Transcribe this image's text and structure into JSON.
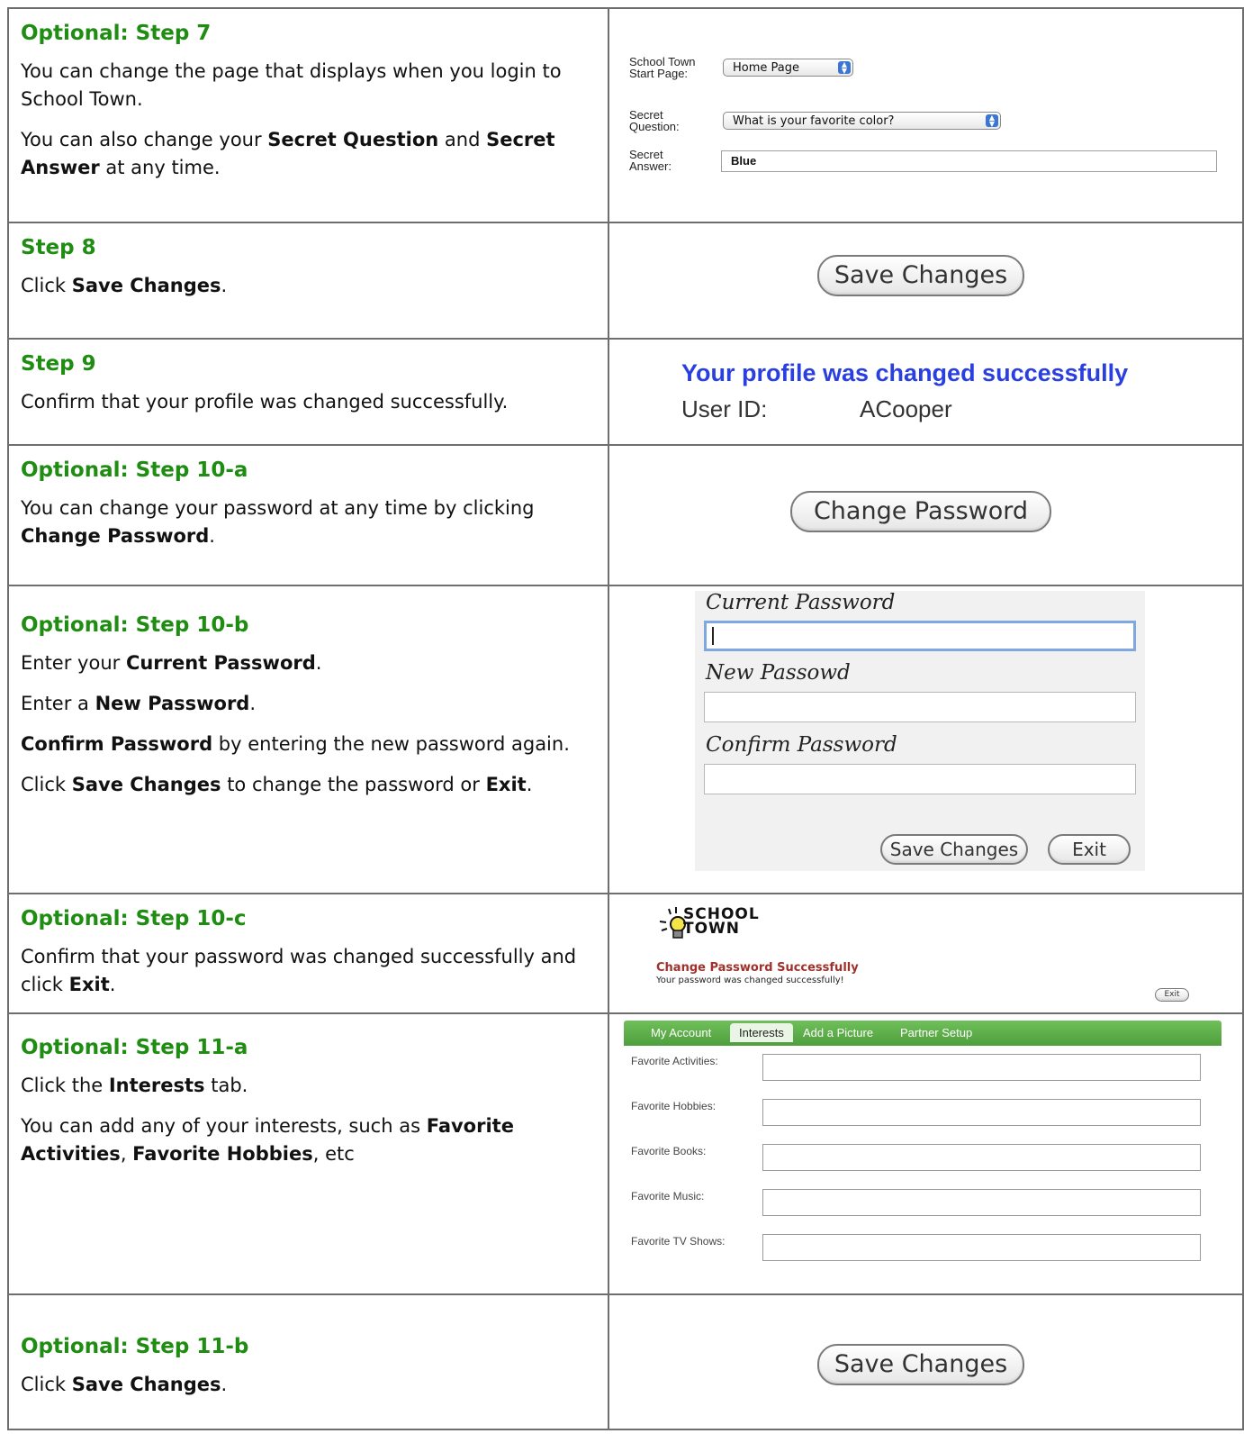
{
  "steps": [
    {
      "title": "Optional: Step 7",
      "paragraphs": [
        "You can change the page that displays when you login to School Town.",
        "You can also change your {Secret Question} and {Secret Answer} at any time."
      ]
    },
    {
      "title": "Step 8",
      "paragraphs": [
        "Click {Save Changes}."
      ]
    },
    {
      "title": "Step 9",
      "paragraphs": [
        "Confirm that your profile was changed successfully."
      ]
    },
    {
      "title": "Optional: Step 10-a",
      "paragraphs": [
        "You can change your password at any time by clicking {Change Password}."
      ]
    },
    {
      "title": "Optional: Step 10-b",
      "paragraphs": [
        "Enter your {Current Password}.",
        "Enter a {New Password}.",
        "{Confirm Password} by entering the new password again.",
        "Click {Save Changes} to change the password or {Exit}."
      ]
    },
    {
      "title": "Optional: Step 10-c",
      "paragraphs": [
        "Confirm that your password was changed successfully and click {Exit}."
      ]
    },
    {
      "title": "Optional: Step 11-a",
      "paragraphs": [
        "Click the {Interests} tab.",
        "You can add any of your interests, such as {Favorite Activities}, {Favorite Hobbies}, etc"
      ]
    },
    {
      "title": "Optional: Step 11-b",
      "paragraphs": [
        "Click {Save Changes}."
      ]
    }
  ],
  "step7": {
    "start_page_label": "School Town Start Page:",
    "start_page_value": "Home Page",
    "question_label": "Secret Question:",
    "question_value": "What is your favorite color?",
    "answer_label": "Secret Answer:",
    "answer_value": "Blue"
  },
  "step8": {
    "button": "Save Changes"
  },
  "step9": {
    "message": "Your profile was changed successfully",
    "user_id_label": "User ID:",
    "user_id_value": "ACooper"
  },
  "step10a": {
    "button": "Change Password"
  },
  "step10b": {
    "current_label": "Current Password",
    "new_label": "New Passowd",
    "confirm_label": "Confirm Password",
    "save_button": "Save Changes",
    "exit_button": "Exit"
  },
  "step10c": {
    "logo_text": "SCHOOL TOWN",
    "heading": "Change Password Successfully",
    "message": "Your password was changed successfully!",
    "exit_button": "Exit"
  },
  "step11a": {
    "tabs": [
      "My Account",
      "Interests",
      "Add a Picture",
      "Partner Setup"
    ],
    "fields": [
      "Favorite Activities:",
      "Favorite Hobbies:",
      "Favorite Books:",
      "Favorite Music:",
      "Favorite TV Shows:"
    ]
  },
  "step11b": {
    "button": "Save Changes"
  },
  "colors": {
    "step_title": "#1f8c12",
    "success_blue": "#2a3fe0",
    "tab_green": "#5aaf46",
    "logo_red": "#a0302a"
  }
}
